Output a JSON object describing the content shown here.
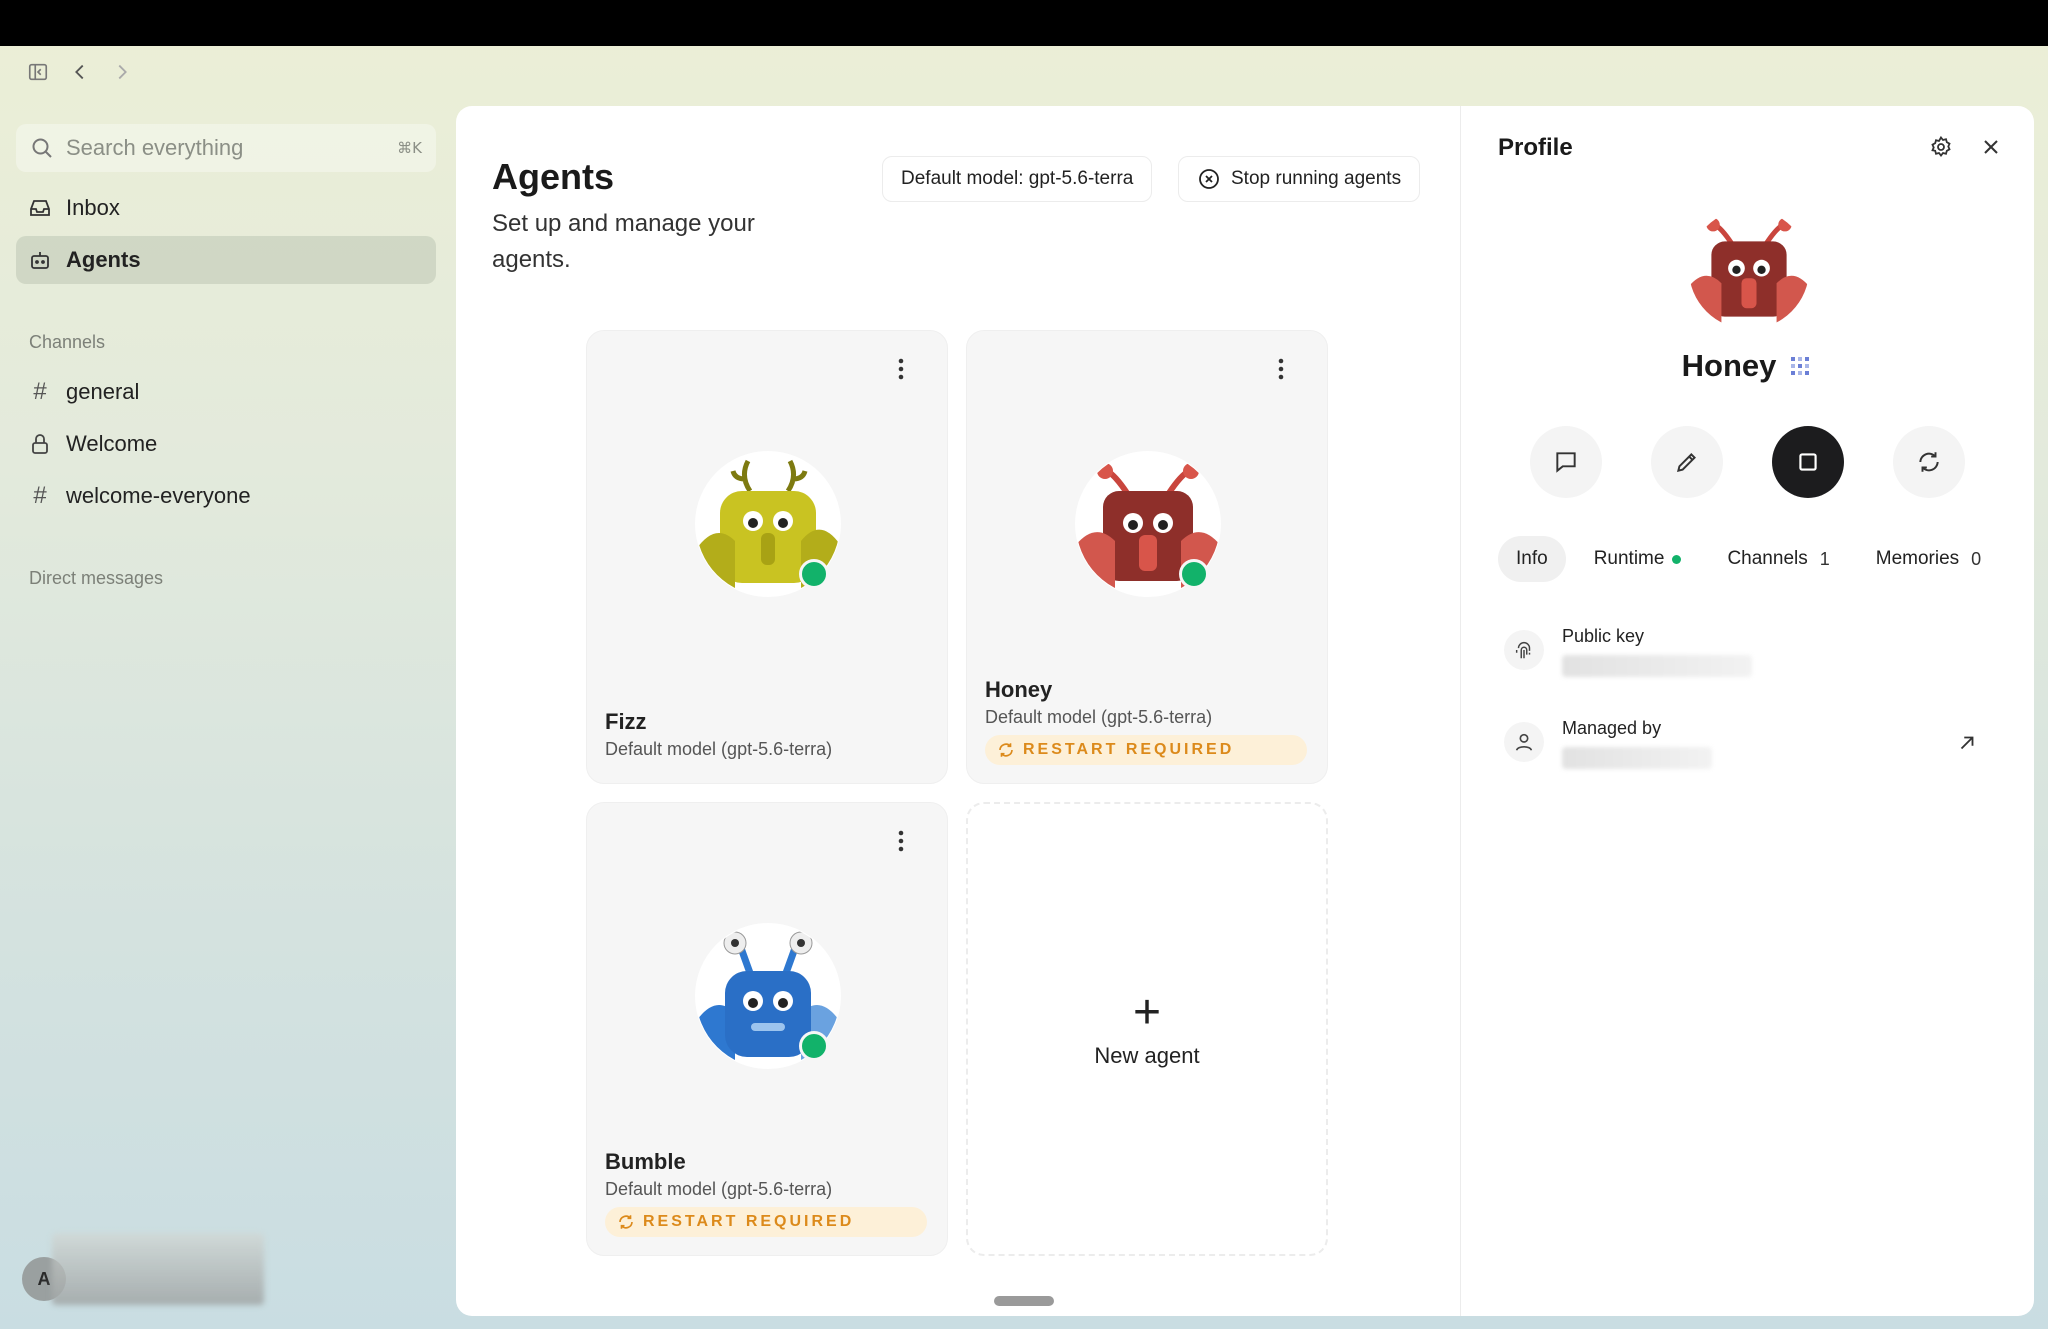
{
  "sidebar": {
    "search_placeholder": "Search everything",
    "search_shortcut": "⌘K",
    "items": [
      {
        "label": "Inbox",
        "icon": "inbox-icon"
      },
      {
        "label": "Agents",
        "icon": "robot-icon",
        "active": true
      }
    ],
    "channels_label": "Channels",
    "channels": [
      {
        "label": "general",
        "icon": "hash"
      },
      {
        "label": "Welcome",
        "icon": "lock"
      },
      {
        "label": "welcome-everyone",
        "icon": "hash"
      }
    ],
    "dm_label": "Direct messages",
    "user_initial": "A"
  },
  "main": {
    "title": "Agents",
    "subtitle": "Set up and manage your agents.",
    "default_model_btn": "Default model: gpt-5.6-terra",
    "stop_btn": "Stop running agents",
    "cards": [
      {
        "name": "Fizz",
        "model": "Default model (gpt-5.6-terra)",
        "restart": false,
        "color": "#c9c322",
        "status": "online"
      },
      {
        "name": "Honey",
        "model": "Default model (gpt-5.6-terra)",
        "restart": true,
        "color": "#b8403a",
        "status": "online"
      },
      {
        "name": "Bumble",
        "model": "Default model (gpt-5.6-terra)",
        "restart": true,
        "color": "#2e78d0",
        "status": "online"
      }
    ],
    "restart_label": "RESTART REQUIRED",
    "new_agent_label": "New agent"
  },
  "profile": {
    "title": "Profile",
    "name": "Honey",
    "tabs": [
      {
        "label": "Info",
        "active": true
      },
      {
        "label": "Runtime",
        "dot": true
      },
      {
        "label": "Channels",
        "count": "1"
      },
      {
        "label": "Memories",
        "count": "0"
      }
    ],
    "public_key_label": "Public key",
    "managed_by_label": "Managed by"
  },
  "colors": {
    "online": "#12b26a",
    "restart_text": "#dc8a1b",
    "restart_bg": "#fdf0d8"
  }
}
